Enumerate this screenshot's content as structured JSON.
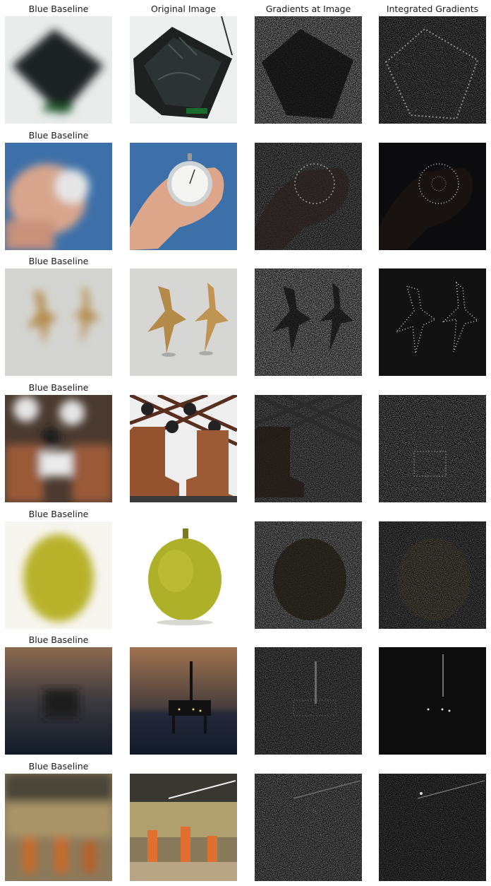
{
  "headers": {
    "baseline": "Blue Baseline",
    "original": "Original Image",
    "gradients": "Gradients at Image",
    "integrated": "Integrated Gradients"
  },
  "rows": [
    {
      "baseline_title": "Blue Baseline",
      "subject": "dark leather case on white"
    },
    {
      "baseline_title": "Blue Baseline",
      "subject": "hand holding stopwatch on blue"
    },
    {
      "baseline_title": "Blue Baseline",
      "subject": "two gold starfish"
    },
    {
      "baseline_title": "Blue Baseline",
      "subject": "brown leather boots before wine rack"
    },
    {
      "baseline_title": "Blue Baseline",
      "subject": "jackfruit on white"
    },
    {
      "baseline_title": "Blue Baseline",
      "subject": "oil platform at dusk"
    },
    {
      "baseline_title": "Blue Baseline",
      "subject": "volleyball match in arena"
    }
  ],
  "colors": {
    "text": "#1a1a1a",
    "attribution_bg": "#151515",
    "row_bg": [
      "#e9eceb",
      "#3d70a8",
      "#d4d5d2",
      "#6e4a33",
      "#f7f5ef",
      "#3a3734",
      "#8a7a5c"
    ]
  }
}
